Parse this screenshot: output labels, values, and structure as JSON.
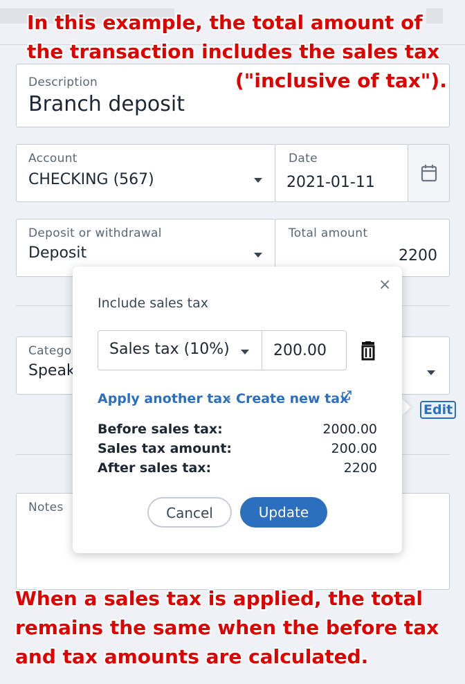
{
  "annotations": {
    "top_line1": "In this example, the total amount of",
    "top_line2": "the transaction includes the sales tax",
    "top_line3": "(\"inclusive of tax\").",
    "bottom_line1": "When a sales tax is applied, the total",
    "bottom_line2": "remains the same when the before tax",
    "bottom_line3": "and tax amounts are calculated."
  },
  "form": {
    "description": {
      "label": "Description",
      "value": "Branch deposit"
    },
    "account": {
      "label": "Account",
      "value": "CHECKING (567)"
    },
    "date": {
      "label": "Date",
      "value": "2021-01-11"
    },
    "deposit_withdrawal": {
      "label": "Deposit or withdrawal",
      "value": "Deposit"
    },
    "total_amount": {
      "label": "Total amount",
      "value": "2200"
    },
    "category": {
      "label": "Catego",
      "value": "Speak"
    },
    "notes": {
      "label": "Notes"
    },
    "edit_link": "Edit"
  },
  "sales_tax_popup": {
    "title": "Include sales tax",
    "tax_select": "Sales tax (10%)",
    "tax_amount": "200.00",
    "apply_another": "Apply another tax",
    "create_new": "Create new tax",
    "separator": "•",
    "summary": [
      {
        "label": "Before sales tax:",
        "value": "2000.00"
      },
      {
        "label": "Sales tax amount:",
        "value": "200.00"
      },
      {
        "label": "After sales tax:",
        "value": "2200"
      }
    ],
    "cancel_label": "Cancel",
    "update_label": "Update",
    "close_glyph": "×"
  },
  "colors": {
    "accent": "#2d6fbf",
    "annotation": "#e00000",
    "background": "#eef1f5"
  },
  "icons": [
    "calendar-icon",
    "chevron-down-icon",
    "trash-icon",
    "external-link-icon",
    "close-icon"
  ]
}
